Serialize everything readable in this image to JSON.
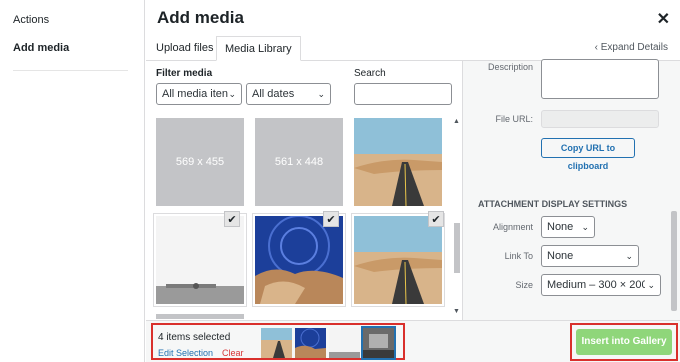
{
  "sidebar": {
    "items": [
      {
        "label": "Actions"
      },
      {
        "label": "Add media"
      }
    ]
  },
  "modal": {
    "title": "Add media",
    "close_icon": "close-icon"
  },
  "tabs": [
    {
      "label": "Upload files"
    },
    {
      "label": "Media Library"
    }
  ],
  "expand_details": "Expand Details",
  "toolbar": {
    "filter_label": "Filter media",
    "media_type": "All media iten",
    "dates": "All dates",
    "search_label": "Search",
    "search_value": ""
  },
  "grid": {
    "placeholders": [
      {
        "label": "569 x 455"
      },
      {
        "label": "561 x 448"
      }
    ]
  },
  "details": {
    "description_label": "Description",
    "file_url_label": "File URL:",
    "copy_url_label": "Copy URL to clipboard",
    "settings_title": "ATTACHMENT DISPLAY SETTINGS",
    "alignment_label": "Alignment",
    "alignment_value": "None",
    "link_to_label": "Link To",
    "link_to_value": "None",
    "size_label": "Size",
    "size_value": "Medium – 300 × 200"
  },
  "footer": {
    "selected_count": "4 items selected",
    "edit_selection": "Edit Selection",
    "clear": "Clear",
    "insert_label": "Insert into Gallery"
  },
  "colors": {
    "accent": "#2271b1",
    "insert_button": "#8fd67a",
    "highlight_border": "#d9302c",
    "clear_link": "#d63638"
  }
}
